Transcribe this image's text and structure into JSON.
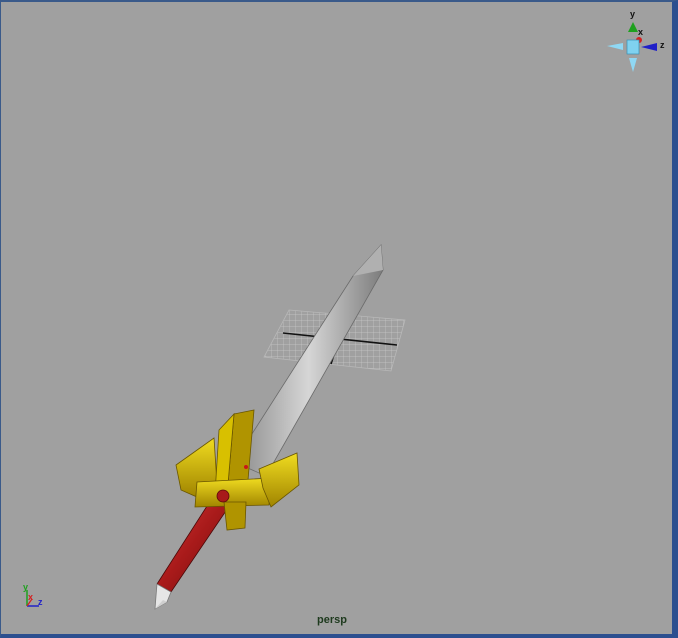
{
  "viewport": {
    "camera_name": "persp",
    "background_color": "#a0a0a0",
    "border_color": "#2c4f8f"
  },
  "view_cube": {
    "label_y": "y",
    "label_x": "x",
    "label_z": "z"
  },
  "axis_indicator": {
    "label_y": "y",
    "label_x": "x",
    "label_z": "z"
  },
  "scene_objects": {
    "sword_blade": {
      "icon": "sword-blade",
      "color": "#c8c8c8"
    },
    "sword_guard": {
      "icon": "sword-guard",
      "color": "#d4b800"
    },
    "sword_handle": {
      "icon": "sword-handle",
      "color": "#a81a1a"
    },
    "ground_grid": {
      "icon": "grid"
    }
  }
}
